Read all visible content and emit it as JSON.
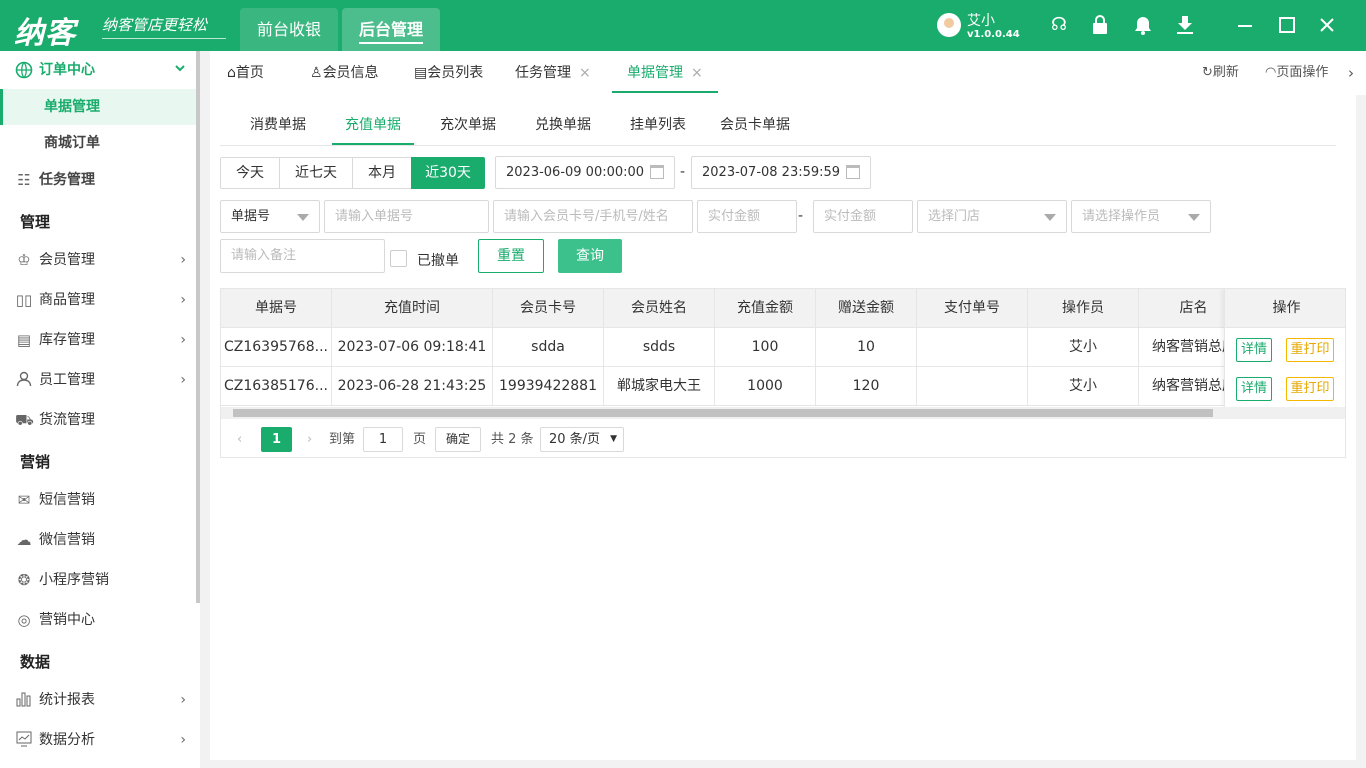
{
  "topbar": {
    "logo": "纳客",
    "slogan": "纳客管店更轻松",
    "tabs": [
      {
        "label": "前台收银"
      },
      {
        "label": "后台管理"
      }
    ],
    "user_name": "艾小",
    "version": "v1.0.0.44",
    "icons": [
      "headset-icon",
      "lock-icon",
      "bell-icon",
      "download-icon",
      "minimize-icon",
      "maximize-icon",
      "close-icon"
    ],
    "accent": "#1aac6d"
  },
  "sidebar": {
    "order_center": "订单中心",
    "order_sub": [
      "单据管理",
      "商城订单"
    ],
    "task": "任务管理",
    "group_manage": "管理",
    "manage_items": [
      "会员管理",
      "商品管理",
      "库存管理",
      "员工管理",
      "货流管理"
    ],
    "group_marketing": "营销",
    "marketing_items": [
      "短信营销",
      "微信营销",
      "小程序营销",
      "营销中心"
    ],
    "group_data": "数据",
    "data_items": [
      "统计报表",
      "数据分析"
    ]
  },
  "pagetabs": {
    "items": [
      "首页",
      "会员信息",
      "会员列表",
      "任务管理",
      "单据管理"
    ],
    "refresh": "刷新",
    "page_ops": "页面操作"
  },
  "subtabs": [
    "消费单据",
    "充值单据",
    "充次单据",
    "兑换单据",
    "挂单列表",
    "会员卡单据"
  ],
  "filters": {
    "quick": [
      "今天",
      "近七天",
      "本月",
      "近30天"
    ],
    "date_start": "2023-06-09 00:00:00",
    "date_end": "2023-07-08 23:59:59",
    "doc_type": "单据号",
    "doc_placeholder": "请输入单据号",
    "member_placeholder": "请输入会员卡号/手机号/姓名",
    "amount_min": "实付金额",
    "amount_max": "实付金额",
    "store_placeholder": "选择门店",
    "operator_placeholder": "请选择操作员",
    "remark_placeholder": "请输入备注",
    "revoked_label": "已撤单",
    "reset": "重置",
    "query": "查询"
  },
  "table": {
    "headers": [
      "单据号",
      "充值时间",
      "会员卡号",
      "会员姓名",
      "充值金额",
      "赠送金额",
      "支付单号",
      "操作员",
      "店名",
      "操作"
    ],
    "rows": [
      [
        "CZ16395768...",
        "2023-07-06 09:18:41",
        "sdda",
        "sdds",
        "100",
        "10",
        "",
        "艾小",
        "纳客营销总店"
      ],
      [
        "CZ16385176...",
        "2023-06-28 21:43:25",
        "19939422881",
        "郸城家电大王",
        "1000",
        "120",
        "",
        "艾小",
        "纳客营销总店"
      ]
    ],
    "detail": "详情",
    "reprint": "重打印"
  },
  "pager": {
    "current": "1",
    "goto": "到第",
    "page_input": "1",
    "page_unit": "页",
    "confirm": "确定",
    "total": "共 2 条",
    "page_size": "20 条/页"
  }
}
